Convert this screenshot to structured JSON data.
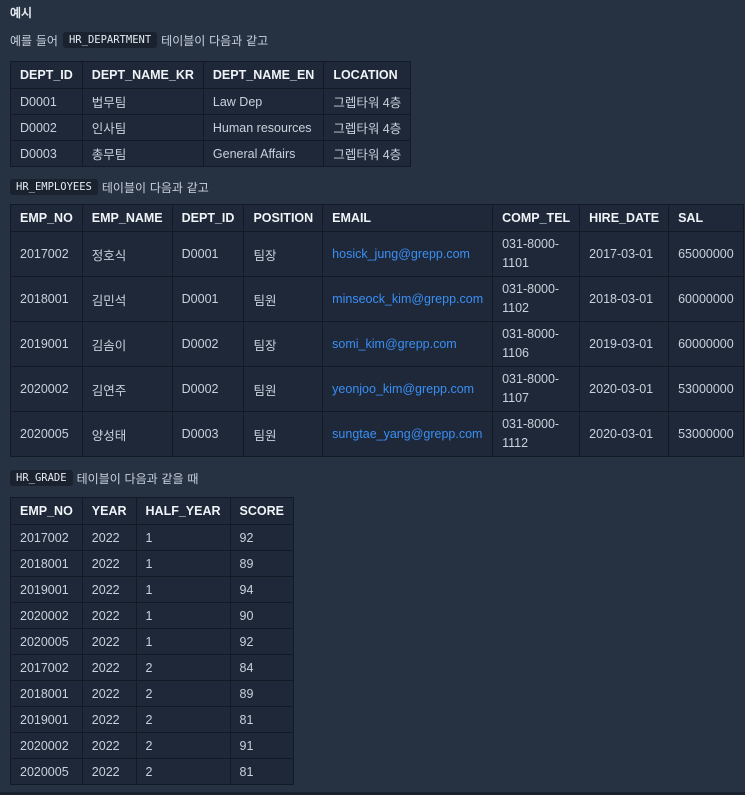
{
  "heading": "예시",
  "dept_intro": {
    "prefix": "예를 들어",
    "code": "HR_DEPARTMENT",
    "suffix": "테이블이 다음과 같고"
  },
  "dept_table": {
    "headers": [
      "DEPT_ID",
      "DEPT_NAME_KR",
      "DEPT_NAME_EN",
      "LOCATION"
    ],
    "rows": [
      [
        "D0001",
        "법무팀",
        "Law Dep",
        "그렙타워 4층"
      ],
      [
        "D0002",
        "인사팀",
        "Human resources",
        "그렙타워 4층"
      ],
      [
        "D0003",
        "총무팀",
        "General Affairs",
        "그렙타워 4층"
      ]
    ]
  },
  "emp_intro": {
    "code": "HR_EMPLOYEES",
    "suffix": "테이블이 다음과 같고"
  },
  "emp_table": {
    "headers": [
      "EMP_NO",
      "EMP_NAME",
      "DEPT_ID",
      "POSITION",
      "EMAIL",
      "COMP_TEL",
      "HIRE_DATE",
      "SAL"
    ],
    "rows": [
      [
        "2017002",
        "정호식",
        "D0001",
        "팀장",
        "hosick_jung@grepp.com",
        "031-8000-1101",
        "2017-03-01",
        "65000000"
      ],
      [
        "2018001",
        "김민석",
        "D0001",
        "팀원",
        "minseock_kim@grepp.com",
        "031-8000-1102",
        "2018-03-01",
        "60000000"
      ],
      [
        "2019001",
        "김솜이",
        "D0002",
        "팀장",
        "somi_kim@grepp.com",
        "031-8000-1106",
        "2019-03-01",
        "60000000"
      ],
      [
        "2020002",
        "김연주",
        "D0002",
        "팀원",
        "yeonjoo_kim@grepp.com",
        "031-8000-1107",
        "2020-03-01",
        "53000000"
      ],
      [
        "2020005",
        "양성태",
        "D0003",
        "팀원",
        "sungtae_yang@grepp.com",
        "031-8000-1112",
        "2020-03-01",
        "53000000"
      ]
    ]
  },
  "grade_intro": {
    "code": "HR_GRADE",
    "suffix": "테이블이 다음과 같을 때"
  },
  "grade_table": {
    "headers": [
      "EMP_NO",
      "YEAR",
      "HALF_YEAR",
      "SCORE"
    ],
    "rows": [
      [
        "2017002",
        "2022",
        "1",
        "92"
      ],
      [
        "2018001",
        "2022",
        "1",
        "89"
      ],
      [
        "2019001",
        "2022",
        "1",
        "94"
      ],
      [
        "2020002",
        "2022",
        "1",
        "90"
      ],
      [
        "2020005",
        "2022",
        "1",
        "92"
      ],
      [
        "2017002",
        "2022",
        "2",
        "84"
      ],
      [
        "2018001",
        "2022",
        "2",
        "89"
      ],
      [
        "2019001",
        "2022",
        "2",
        "81"
      ],
      [
        "2020002",
        "2022",
        "2",
        "91"
      ],
      [
        "2020005",
        "2022",
        "2",
        "81"
      ]
    ]
  },
  "colors": {
    "background": "#263142",
    "table_bg": "#1e2838",
    "link": "#3a8ff5",
    "code_bg": "#1a2230"
  }
}
